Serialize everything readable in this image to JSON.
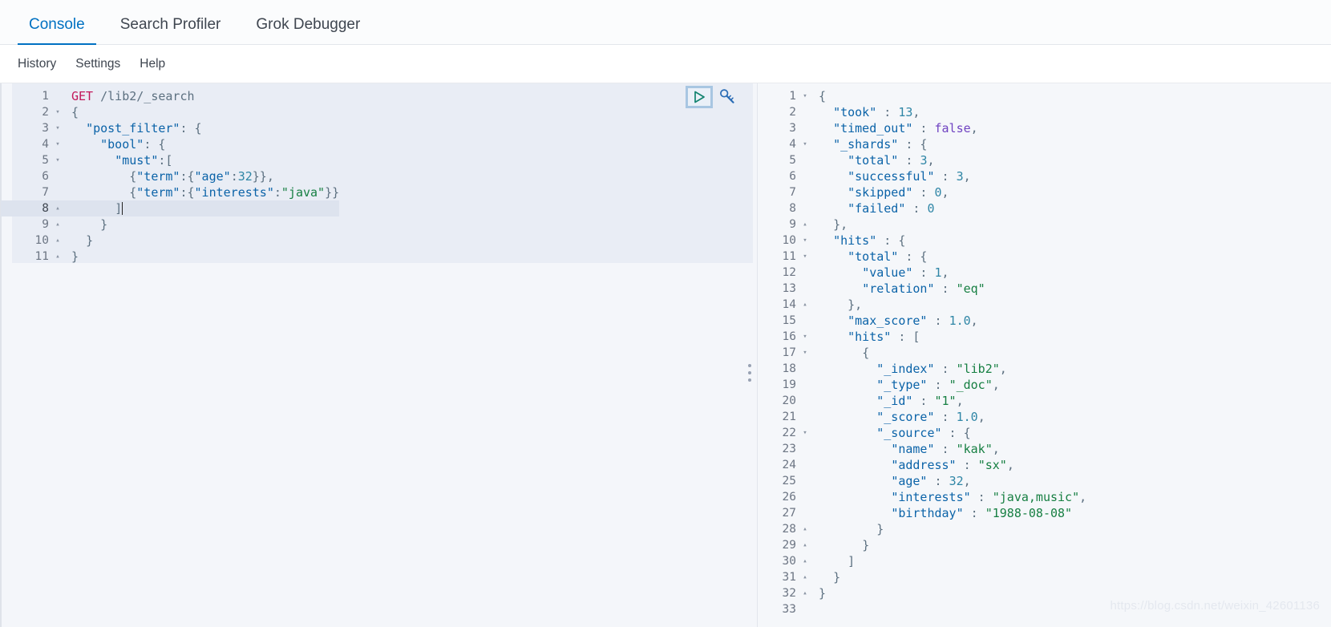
{
  "tabs": [
    {
      "label": "Console",
      "active": true
    },
    {
      "label": "Search Profiler",
      "active": false
    },
    {
      "label": "Grok Debugger",
      "active": false
    }
  ],
  "menu": [
    {
      "label": "History"
    },
    {
      "label": "Settings"
    },
    {
      "label": "Help"
    }
  ],
  "actions": {
    "play_title": "Click to send request",
    "wrench_title": "Open documentation"
  },
  "request_editor": {
    "active_line": 8,
    "lines": [
      {
        "num": 1,
        "fold": "",
        "tokens": [
          {
            "t": "method",
            "v": "GET"
          },
          {
            "t": "plain",
            "v": " "
          },
          {
            "t": "url",
            "v": "/lib2/_search"
          }
        ]
      },
      {
        "num": 2,
        "fold": "▾",
        "tokens": [
          {
            "t": "punc",
            "v": "{"
          }
        ]
      },
      {
        "num": 3,
        "fold": "▾",
        "tokens": [
          {
            "t": "plain",
            "v": "  "
          },
          {
            "t": "key",
            "v": "\"post_filter\""
          },
          {
            "t": "punc",
            "v": ": {"
          }
        ]
      },
      {
        "num": 4,
        "fold": "▾",
        "tokens": [
          {
            "t": "plain",
            "v": "    "
          },
          {
            "t": "key",
            "v": "\"bool\""
          },
          {
            "t": "punc",
            "v": ": {"
          }
        ]
      },
      {
        "num": 5,
        "fold": "▾",
        "tokens": [
          {
            "t": "plain",
            "v": "      "
          },
          {
            "t": "key",
            "v": "\"must\""
          },
          {
            "t": "punc",
            "v": ":["
          }
        ]
      },
      {
        "num": 6,
        "fold": "",
        "tokens": [
          {
            "t": "plain",
            "v": "        "
          },
          {
            "t": "punc",
            "v": "{"
          },
          {
            "t": "key",
            "v": "\"term\""
          },
          {
            "t": "punc",
            "v": ":{"
          },
          {
            "t": "key",
            "v": "\"age\""
          },
          {
            "t": "punc",
            "v": ":"
          },
          {
            "t": "num",
            "v": "32"
          },
          {
            "t": "punc",
            "v": "}},"
          }
        ]
      },
      {
        "num": 7,
        "fold": "",
        "tokens": [
          {
            "t": "plain",
            "v": "        "
          },
          {
            "t": "punc",
            "v": "{"
          },
          {
            "t": "key",
            "v": "\"term\""
          },
          {
            "t": "punc",
            "v": ":{"
          },
          {
            "t": "key",
            "v": "\"interests\""
          },
          {
            "t": "punc",
            "v": ":"
          },
          {
            "t": "str",
            "v": "\"java\""
          },
          {
            "t": "punc",
            "v": "}}"
          }
        ]
      },
      {
        "num": 8,
        "fold": "▴",
        "tokens": [
          {
            "t": "plain",
            "v": "      "
          },
          {
            "t": "punc",
            "v": "]"
          }
        ],
        "caret": true
      },
      {
        "num": 9,
        "fold": "▴",
        "tokens": [
          {
            "t": "plain",
            "v": "    "
          },
          {
            "t": "punc",
            "v": "}"
          }
        ]
      },
      {
        "num": 10,
        "fold": "▴",
        "tokens": [
          {
            "t": "plain",
            "v": "  "
          },
          {
            "t": "punc",
            "v": "}"
          }
        ]
      },
      {
        "num": 11,
        "fold": "▴",
        "tokens": [
          {
            "t": "punc",
            "v": "}"
          }
        ]
      }
    ]
  },
  "response_viewer": {
    "lines": [
      {
        "num": 1,
        "fold": "▾",
        "tokens": [
          {
            "t": "punc",
            "v": "{"
          }
        ]
      },
      {
        "num": 2,
        "fold": "",
        "tokens": [
          {
            "t": "plain",
            "v": "  "
          },
          {
            "t": "key",
            "v": "\"took\""
          },
          {
            "t": "punc",
            "v": " : "
          },
          {
            "t": "num",
            "v": "13"
          },
          {
            "t": "punc",
            "v": ","
          }
        ]
      },
      {
        "num": 3,
        "fold": "",
        "tokens": [
          {
            "t": "plain",
            "v": "  "
          },
          {
            "t": "key",
            "v": "\"timed_out\""
          },
          {
            "t": "punc",
            "v": " : "
          },
          {
            "t": "bool",
            "v": "false"
          },
          {
            "t": "punc",
            "v": ","
          }
        ]
      },
      {
        "num": 4,
        "fold": "▾",
        "tokens": [
          {
            "t": "plain",
            "v": "  "
          },
          {
            "t": "key",
            "v": "\"_shards\""
          },
          {
            "t": "punc",
            "v": " : {"
          }
        ]
      },
      {
        "num": 5,
        "fold": "",
        "tokens": [
          {
            "t": "plain",
            "v": "    "
          },
          {
            "t": "key",
            "v": "\"total\""
          },
          {
            "t": "punc",
            "v": " : "
          },
          {
            "t": "num",
            "v": "3"
          },
          {
            "t": "punc",
            "v": ","
          }
        ]
      },
      {
        "num": 6,
        "fold": "",
        "tokens": [
          {
            "t": "plain",
            "v": "    "
          },
          {
            "t": "key",
            "v": "\"successful\""
          },
          {
            "t": "punc",
            "v": " : "
          },
          {
            "t": "num",
            "v": "3"
          },
          {
            "t": "punc",
            "v": ","
          }
        ]
      },
      {
        "num": 7,
        "fold": "",
        "tokens": [
          {
            "t": "plain",
            "v": "    "
          },
          {
            "t": "key",
            "v": "\"skipped\""
          },
          {
            "t": "punc",
            "v": " : "
          },
          {
            "t": "num",
            "v": "0"
          },
          {
            "t": "punc",
            "v": ","
          }
        ]
      },
      {
        "num": 8,
        "fold": "",
        "tokens": [
          {
            "t": "plain",
            "v": "    "
          },
          {
            "t": "key",
            "v": "\"failed\""
          },
          {
            "t": "punc",
            "v": " : "
          },
          {
            "t": "num",
            "v": "0"
          }
        ]
      },
      {
        "num": 9,
        "fold": "▴",
        "tokens": [
          {
            "t": "plain",
            "v": "  "
          },
          {
            "t": "punc",
            "v": "},"
          }
        ]
      },
      {
        "num": 10,
        "fold": "▾",
        "tokens": [
          {
            "t": "plain",
            "v": "  "
          },
          {
            "t": "key",
            "v": "\"hits\""
          },
          {
            "t": "punc",
            "v": " : {"
          }
        ]
      },
      {
        "num": 11,
        "fold": "▾",
        "tokens": [
          {
            "t": "plain",
            "v": "    "
          },
          {
            "t": "key",
            "v": "\"total\""
          },
          {
            "t": "punc",
            "v": " : {"
          }
        ]
      },
      {
        "num": 12,
        "fold": "",
        "tokens": [
          {
            "t": "plain",
            "v": "      "
          },
          {
            "t": "key",
            "v": "\"value\""
          },
          {
            "t": "punc",
            "v": " : "
          },
          {
            "t": "num",
            "v": "1"
          },
          {
            "t": "punc",
            "v": ","
          }
        ]
      },
      {
        "num": 13,
        "fold": "",
        "tokens": [
          {
            "t": "plain",
            "v": "      "
          },
          {
            "t": "key",
            "v": "\"relation\""
          },
          {
            "t": "punc",
            "v": " : "
          },
          {
            "t": "str",
            "v": "\"eq\""
          }
        ]
      },
      {
        "num": 14,
        "fold": "▴",
        "tokens": [
          {
            "t": "plain",
            "v": "    "
          },
          {
            "t": "punc",
            "v": "},"
          }
        ]
      },
      {
        "num": 15,
        "fold": "",
        "tokens": [
          {
            "t": "plain",
            "v": "    "
          },
          {
            "t": "key",
            "v": "\"max_score\""
          },
          {
            "t": "punc",
            "v": " : "
          },
          {
            "t": "num",
            "v": "1.0"
          },
          {
            "t": "punc",
            "v": ","
          }
        ]
      },
      {
        "num": 16,
        "fold": "▾",
        "tokens": [
          {
            "t": "plain",
            "v": "    "
          },
          {
            "t": "key",
            "v": "\"hits\""
          },
          {
            "t": "punc",
            "v": " : ["
          }
        ]
      },
      {
        "num": 17,
        "fold": "▾",
        "tokens": [
          {
            "t": "plain",
            "v": "      "
          },
          {
            "t": "punc",
            "v": "{"
          }
        ]
      },
      {
        "num": 18,
        "fold": "",
        "tokens": [
          {
            "t": "plain",
            "v": "        "
          },
          {
            "t": "key",
            "v": "\"_index\""
          },
          {
            "t": "punc",
            "v": " : "
          },
          {
            "t": "str",
            "v": "\"lib2\""
          },
          {
            "t": "punc",
            "v": ","
          }
        ]
      },
      {
        "num": 19,
        "fold": "",
        "tokens": [
          {
            "t": "plain",
            "v": "        "
          },
          {
            "t": "key",
            "v": "\"_type\""
          },
          {
            "t": "punc",
            "v": " : "
          },
          {
            "t": "str",
            "v": "\"_doc\""
          },
          {
            "t": "punc",
            "v": ","
          }
        ]
      },
      {
        "num": 20,
        "fold": "",
        "tokens": [
          {
            "t": "plain",
            "v": "        "
          },
          {
            "t": "key",
            "v": "\"_id\""
          },
          {
            "t": "punc",
            "v": " : "
          },
          {
            "t": "str",
            "v": "\"1\""
          },
          {
            "t": "punc",
            "v": ","
          }
        ]
      },
      {
        "num": 21,
        "fold": "",
        "tokens": [
          {
            "t": "plain",
            "v": "        "
          },
          {
            "t": "key",
            "v": "\"_score\""
          },
          {
            "t": "punc",
            "v": " : "
          },
          {
            "t": "num",
            "v": "1.0"
          },
          {
            "t": "punc",
            "v": ","
          }
        ]
      },
      {
        "num": 22,
        "fold": "▾",
        "tokens": [
          {
            "t": "plain",
            "v": "        "
          },
          {
            "t": "key",
            "v": "\"_source\""
          },
          {
            "t": "punc",
            "v": " : {"
          }
        ]
      },
      {
        "num": 23,
        "fold": "",
        "tokens": [
          {
            "t": "plain",
            "v": "          "
          },
          {
            "t": "key",
            "v": "\"name\""
          },
          {
            "t": "punc",
            "v": " : "
          },
          {
            "t": "str",
            "v": "\"kak\""
          },
          {
            "t": "punc",
            "v": ","
          }
        ]
      },
      {
        "num": 24,
        "fold": "",
        "tokens": [
          {
            "t": "plain",
            "v": "          "
          },
          {
            "t": "key",
            "v": "\"address\""
          },
          {
            "t": "punc",
            "v": " : "
          },
          {
            "t": "str",
            "v": "\"sx\""
          },
          {
            "t": "punc",
            "v": ","
          }
        ]
      },
      {
        "num": 25,
        "fold": "",
        "tokens": [
          {
            "t": "plain",
            "v": "          "
          },
          {
            "t": "key",
            "v": "\"age\""
          },
          {
            "t": "punc",
            "v": " : "
          },
          {
            "t": "num",
            "v": "32"
          },
          {
            "t": "punc",
            "v": ","
          }
        ]
      },
      {
        "num": 26,
        "fold": "",
        "tokens": [
          {
            "t": "plain",
            "v": "          "
          },
          {
            "t": "key",
            "v": "\"interests\""
          },
          {
            "t": "punc",
            "v": " : "
          },
          {
            "t": "str",
            "v": "\"java,music\""
          },
          {
            "t": "punc",
            "v": ","
          }
        ]
      },
      {
        "num": 27,
        "fold": "",
        "tokens": [
          {
            "t": "plain",
            "v": "          "
          },
          {
            "t": "key",
            "v": "\"birthday\""
          },
          {
            "t": "punc",
            "v": " : "
          },
          {
            "t": "str",
            "v": "\"1988-08-08\""
          }
        ]
      },
      {
        "num": 28,
        "fold": "▴",
        "tokens": [
          {
            "t": "plain",
            "v": "        "
          },
          {
            "t": "punc",
            "v": "}"
          }
        ]
      },
      {
        "num": 29,
        "fold": "▴",
        "tokens": [
          {
            "t": "plain",
            "v": "      "
          },
          {
            "t": "punc",
            "v": "}"
          }
        ]
      },
      {
        "num": 30,
        "fold": "▴",
        "tokens": [
          {
            "t": "plain",
            "v": "    "
          },
          {
            "t": "punc",
            "v": "]"
          }
        ]
      },
      {
        "num": 31,
        "fold": "▴",
        "tokens": [
          {
            "t": "plain",
            "v": "  "
          },
          {
            "t": "punc",
            "v": "}"
          }
        ]
      },
      {
        "num": 32,
        "fold": "▴",
        "tokens": [
          {
            "t": "punc",
            "v": "}"
          }
        ]
      },
      {
        "num": 33,
        "fold": "",
        "tokens": []
      }
    ]
  },
  "watermark": {
    "text": "https://blog.csdn.net/weixin_42601136"
  },
  "colors": {
    "accent": "#0071c2",
    "method": "#c2185b",
    "key": "#0b63a8",
    "string": "#167f42",
    "number": "#2f86a6",
    "boolean": "#6f42c1",
    "editor_bg": "#e9edf5",
    "response_bg": "#f5f7fa",
    "active_line": "#dde3ee"
  }
}
